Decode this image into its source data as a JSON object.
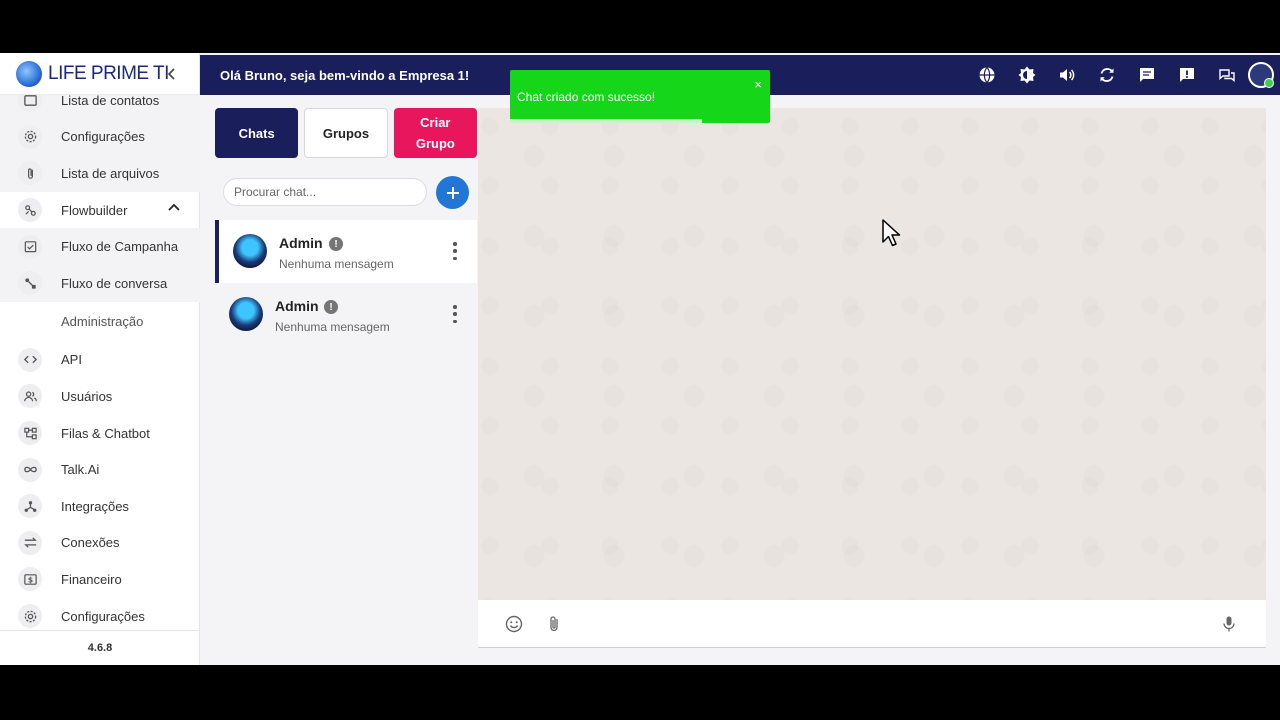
{
  "brand": {
    "name": "LIFE PRIME TI"
  },
  "header": {
    "welcome": "Olá Bruno, seja bem-vindo a Empresa 1!"
  },
  "sidebar": {
    "items": [
      {
        "label": "Lista de contatos",
        "icon": "contacts-icon"
      },
      {
        "label": "Configurações",
        "icon": "gear-icon"
      },
      {
        "label": "Lista de arquivos",
        "icon": "paperclip-icon"
      },
      {
        "label": "Flowbuilder",
        "icon": "flow-icon"
      },
      {
        "label": "Fluxo de Campanha",
        "icon": "calendar-check-icon"
      },
      {
        "label": "Fluxo de conversa",
        "icon": "conversation-flow-icon"
      },
      {
        "label": "Administração"
      },
      {
        "label": "API",
        "icon": "code-icon"
      },
      {
        "label": "Usuários",
        "icon": "users-icon"
      },
      {
        "label": "Filas & Chatbot",
        "icon": "queue-icon"
      },
      {
        "label": "Talk.Ai",
        "icon": "infinity-icon"
      },
      {
        "label": "Integrações",
        "icon": "integrations-icon"
      },
      {
        "label": "Conexões",
        "icon": "swap-icon"
      },
      {
        "label": "Financeiro",
        "icon": "dollar-icon"
      },
      {
        "label": "Configurações",
        "icon": "gear-icon"
      }
    ],
    "version": "4.6.8"
  },
  "tabs": {
    "chats": "Chats",
    "groups": "Grupos",
    "create_group": "Criar Grupo"
  },
  "search": {
    "placeholder": "Procurar chat..."
  },
  "chats": [
    {
      "name": "Admin",
      "last_message": "Nenhuma mensagem"
    },
    {
      "name": "Admin",
      "last_message": "Nenhuma mensagem"
    }
  ],
  "toast": {
    "message": "Chat criado com sucesso!",
    "close": "×",
    "progress": 0.74
  },
  "colors": {
    "primary": "#1a1f5c",
    "accent": "#e8165d",
    "toast": "#16d61a",
    "add_button": "#2277d6"
  }
}
